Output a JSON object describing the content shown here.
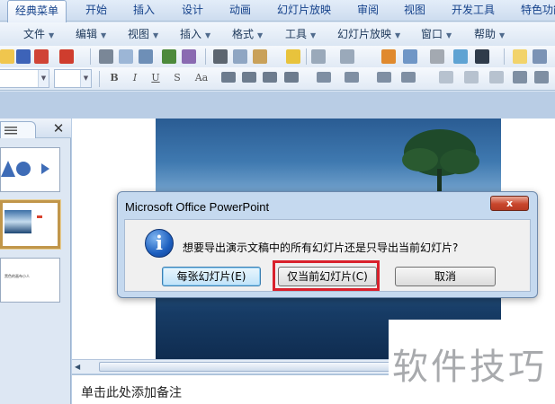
{
  "ribbon_tabs": [
    "经典菜单",
    "开始",
    "插入",
    "设计",
    "动画",
    "幻灯片放映",
    "审阅",
    "视图",
    "开发工具",
    "特色功能"
  ],
  "menu_items": [
    "文件",
    "编辑",
    "视图",
    "插入",
    "格式",
    "工具",
    "幻灯片放映",
    "窗口",
    "帮助"
  ],
  "format_buttons": [
    "B",
    "I",
    "U",
    "S",
    "Aa"
  ],
  "notes": {
    "placeholder": "单击此处添加备注"
  },
  "dialog": {
    "title": "Microsoft Office PowerPoint",
    "close_label": "x",
    "message": "想要导出演示文稿中的所有幻灯片还是只导出当前幻灯片?",
    "icon_glyph": "i",
    "buttons": {
      "every": "每张幻灯片(E)",
      "current": "仅当前幻灯片(C)",
      "cancel": "取消"
    }
  },
  "thumbnails": {
    "slide3_text": "黑色的画布小人"
  },
  "watermark": "软件技巧",
  "colors": {
    "highlight": "#d9212c",
    "ribbon": "#cddcef",
    "accent": "#15428b"
  }
}
